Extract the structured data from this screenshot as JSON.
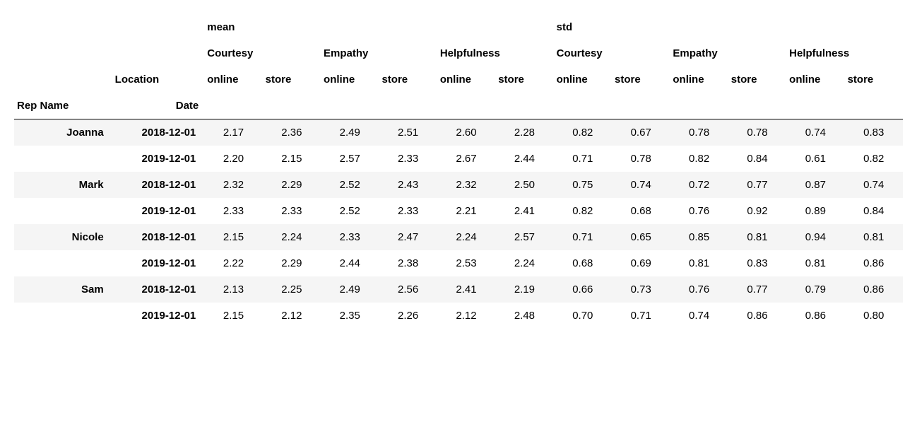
{
  "chart_data": {
    "type": "table",
    "title": "",
    "index_labels": {
      "rep": "Rep Name",
      "date": "Date"
    },
    "location_label": "Location",
    "aggregations": [
      "mean",
      "std"
    ],
    "metrics": [
      "Courtesy",
      "Empathy",
      "Helpfulness"
    ],
    "locations": [
      "online",
      "store"
    ],
    "reps": [
      "Joanna",
      "Mark",
      "Nicole",
      "Sam"
    ],
    "dates": [
      "2018-12-01",
      "2019-12-01"
    ],
    "rows": [
      {
        "rep": "Joanna",
        "date": "2018-12-01",
        "show_rep": true,
        "values": [
          "2.17",
          "2.36",
          "2.49",
          "2.51",
          "2.60",
          "2.28",
          "0.82",
          "0.67",
          "0.78",
          "0.78",
          "0.74",
          "0.83"
        ]
      },
      {
        "rep": "Joanna",
        "date": "2019-12-01",
        "show_rep": false,
        "values": [
          "2.20",
          "2.15",
          "2.57",
          "2.33",
          "2.67",
          "2.44",
          "0.71",
          "0.78",
          "0.82",
          "0.84",
          "0.61",
          "0.82"
        ]
      },
      {
        "rep": "Mark",
        "date": "2018-12-01",
        "show_rep": true,
        "values": [
          "2.32",
          "2.29",
          "2.52",
          "2.43",
          "2.32",
          "2.50",
          "0.75",
          "0.74",
          "0.72",
          "0.77",
          "0.87",
          "0.74"
        ]
      },
      {
        "rep": "Mark",
        "date": "2019-12-01",
        "show_rep": false,
        "values": [
          "2.33",
          "2.33",
          "2.52",
          "2.33",
          "2.21",
          "2.41",
          "0.82",
          "0.68",
          "0.76",
          "0.92",
          "0.89",
          "0.84"
        ]
      },
      {
        "rep": "Nicole",
        "date": "2018-12-01",
        "show_rep": true,
        "values": [
          "2.15",
          "2.24",
          "2.33",
          "2.47",
          "2.24",
          "2.57",
          "0.71",
          "0.65",
          "0.85",
          "0.81",
          "0.94",
          "0.81"
        ]
      },
      {
        "rep": "Nicole",
        "date": "2019-12-01",
        "show_rep": false,
        "values": [
          "2.22",
          "2.29",
          "2.44",
          "2.38",
          "2.53",
          "2.24",
          "0.68",
          "0.69",
          "0.81",
          "0.83",
          "0.81",
          "0.86"
        ]
      },
      {
        "rep": "Sam",
        "date": "2018-12-01",
        "show_rep": true,
        "values": [
          "2.13",
          "2.25",
          "2.49",
          "2.56",
          "2.41",
          "2.19",
          "0.66",
          "0.73",
          "0.76",
          "0.77",
          "0.79",
          "0.86"
        ]
      },
      {
        "rep": "Sam",
        "date": "2019-12-01",
        "show_rep": false,
        "values": [
          "2.15",
          "2.12",
          "2.35",
          "2.26",
          "2.12",
          "2.48",
          "0.70",
          "0.71",
          "0.74",
          "0.86",
          "0.86",
          "0.80"
        ]
      }
    ]
  }
}
